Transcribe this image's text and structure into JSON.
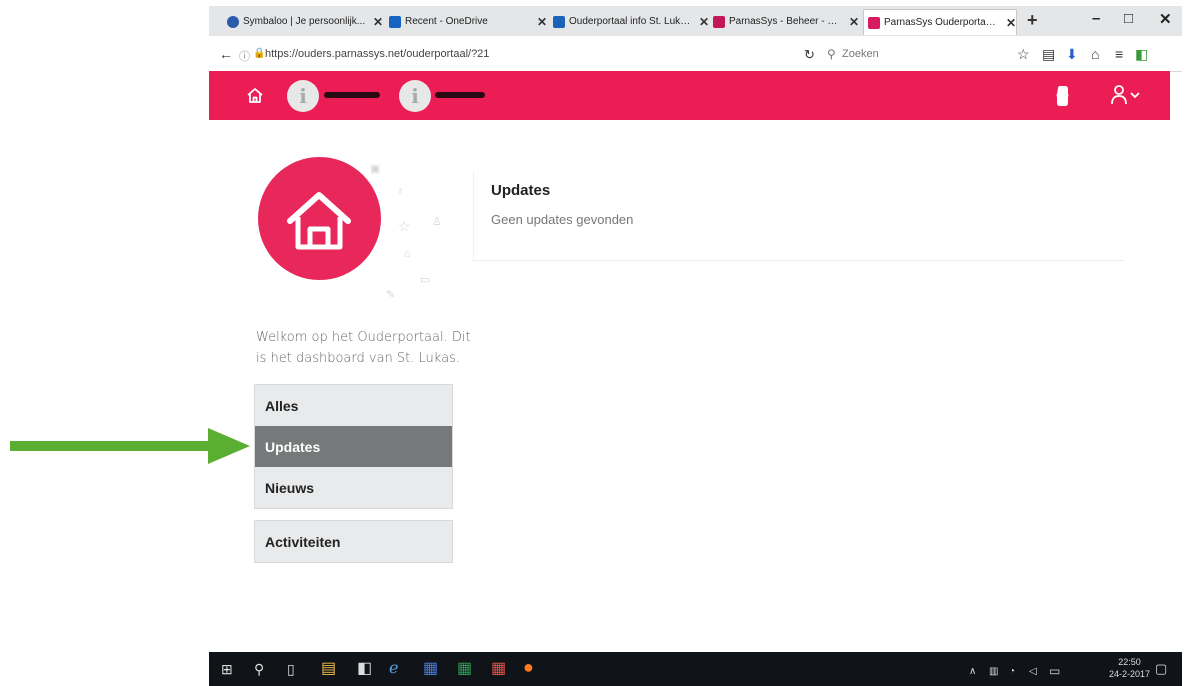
{
  "browser": {
    "tabs": [
      {
        "title": "Symbaloo | Je persoonlijk...",
        "favicon_color": "#2b5cab"
      },
      {
        "title": "Recent - OneDrive",
        "favicon_color": "#1565c0"
      },
      {
        "title": "Ouderportaal info St. Luka...",
        "favicon_color": "#1c63b7"
      },
      {
        "title": "ParnasSys - Beheer - Beheer",
        "favicon_color": "#c2185b"
      },
      {
        "title": "ParnasSys Ouderportaal - ...",
        "favicon_color": "#d81b60"
      }
    ],
    "url": "https://ouders.parnassys.net/ouderportaal/?21",
    "search_placeholder": "Zoeken"
  },
  "header": {
    "accent_color": "#ec1c55"
  },
  "sidebar": {
    "welcome_text": "Welkom op het Ouderportaal. Dit is het dashboard van St. Lukas.",
    "menu1": [
      {
        "label": "Alles"
      },
      {
        "label": "Updates",
        "active": true
      },
      {
        "label": "Nieuws"
      }
    ],
    "menu2": [
      {
        "label": "Activiteiten"
      }
    ]
  },
  "main": {
    "title": "Updates",
    "empty_text": "Geen updates gevonden"
  },
  "taskbar": {
    "time": "22:50",
    "date": "24-2-2017"
  },
  "annotation": {
    "arrow_color": "#5aae32"
  }
}
